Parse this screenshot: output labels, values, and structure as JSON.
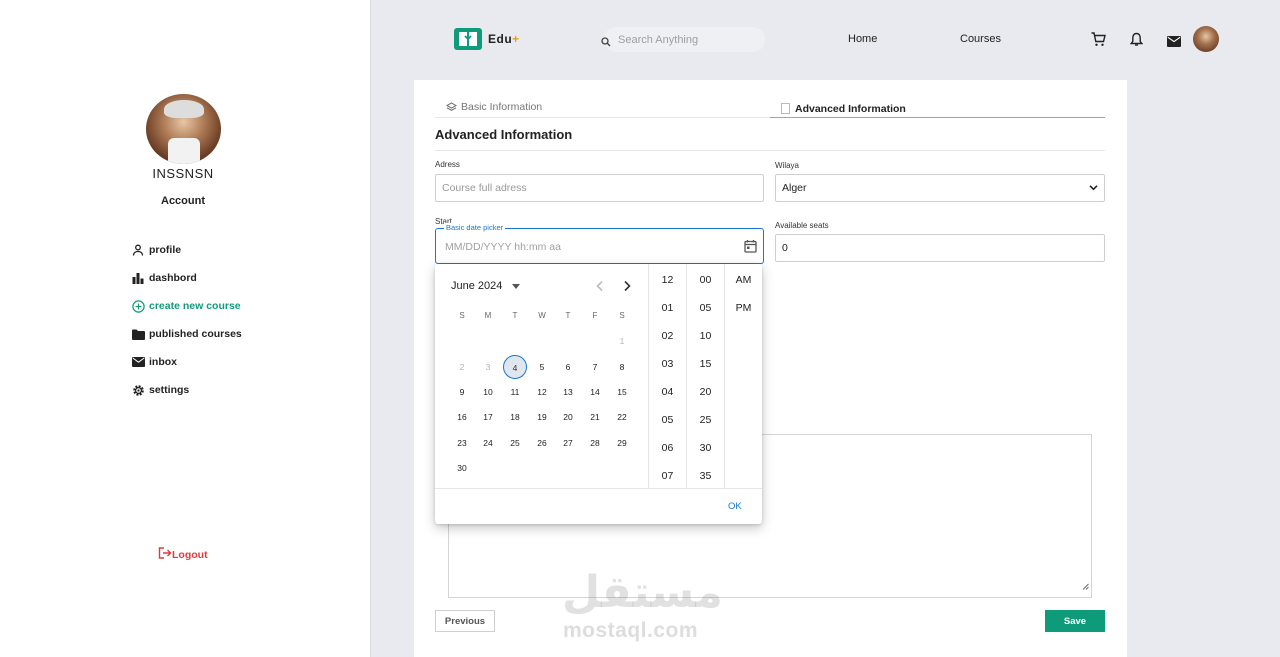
{
  "sidebar": {
    "username": "INSSNSN",
    "account_label": "Account",
    "nav": [
      {
        "label": "profile",
        "icon": "user-icon"
      },
      {
        "label": "dashbord",
        "icon": "bar-chart-icon"
      },
      {
        "label": "create new course",
        "icon": "plus-circle-icon"
      },
      {
        "label": "published courses",
        "icon": "folder-icon"
      },
      {
        "label": "inbox",
        "icon": "mail-icon"
      },
      {
        "label": "settings",
        "icon": "gear-icon"
      }
    ],
    "active_item": "create new course",
    "logout_label": "Logout"
  },
  "header": {
    "logo_text": "Edu",
    "logo_plus": "+",
    "search_placeholder": "Search Anything",
    "links": [
      "Home",
      "Courses"
    ],
    "icons": [
      "cart-icon",
      "bell-icon",
      "mail-icon",
      "avatar"
    ]
  },
  "form": {
    "steps": [
      "Basic Information",
      "Advanced Information"
    ],
    "active_step": "Advanced Information",
    "section_title": "Advanced Information",
    "address": {
      "label": "Adress",
      "placeholder": "Course full adress"
    },
    "wilaya": {
      "label": "Wilaya",
      "value": "Alger"
    },
    "start": {
      "label": "Start",
      "legend": "Basic date picker",
      "placeholder": "MM/DD/YYYY hh:mm aa"
    },
    "seats": {
      "label": "Available seats",
      "value": "0"
    },
    "previous_label": "Previous",
    "save_label": "Save"
  },
  "datepicker": {
    "month_label": "June 2024",
    "weekdays": [
      "S",
      "M",
      "T",
      "W",
      "T",
      "F",
      "S"
    ],
    "leading_muted_days": [
      "1",
      "2",
      "3"
    ],
    "selected_day": "4",
    "days": [
      "1",
      "2",
      "3",
      "4",
      "5",
      "6",
      "7",
      "8",
      "9",
      "10",
      "11",
      "12",
      "13",
      "14",
      "15",
      "16",
      "17",
      "18",
      "19",
      "20",
      "21",
      "22",
      "23",
      "24",
      "25",
      "26",
      "27",
      "28",
      "29",
      "30"
    ],
    "hours": [
      "12",
      "01",
      "02",
      "03",
      "04",
      "05",
      "06",
      "07"
    ],
    "minutes": [
      "00",
      "05",
      "10",
      "15",
      "20",
      "25",
      "30",
      "35"
    ],
    "meridiem": [
      "AM",
      "PM"
    ],
    "ok_label": "OK"
  },
  "watermark": {
    "arabic": "مستقل",
    "latin": "mostaql.com"
  },
  "colors": {
    "accent": "#0e9b7a",
    "picker_blue": "#1976d2",
    "step_underline": "#f08a5d",
    "logout_red": "#e03b3b",
    "logo_plus": "#e6a21a"
  }
}
